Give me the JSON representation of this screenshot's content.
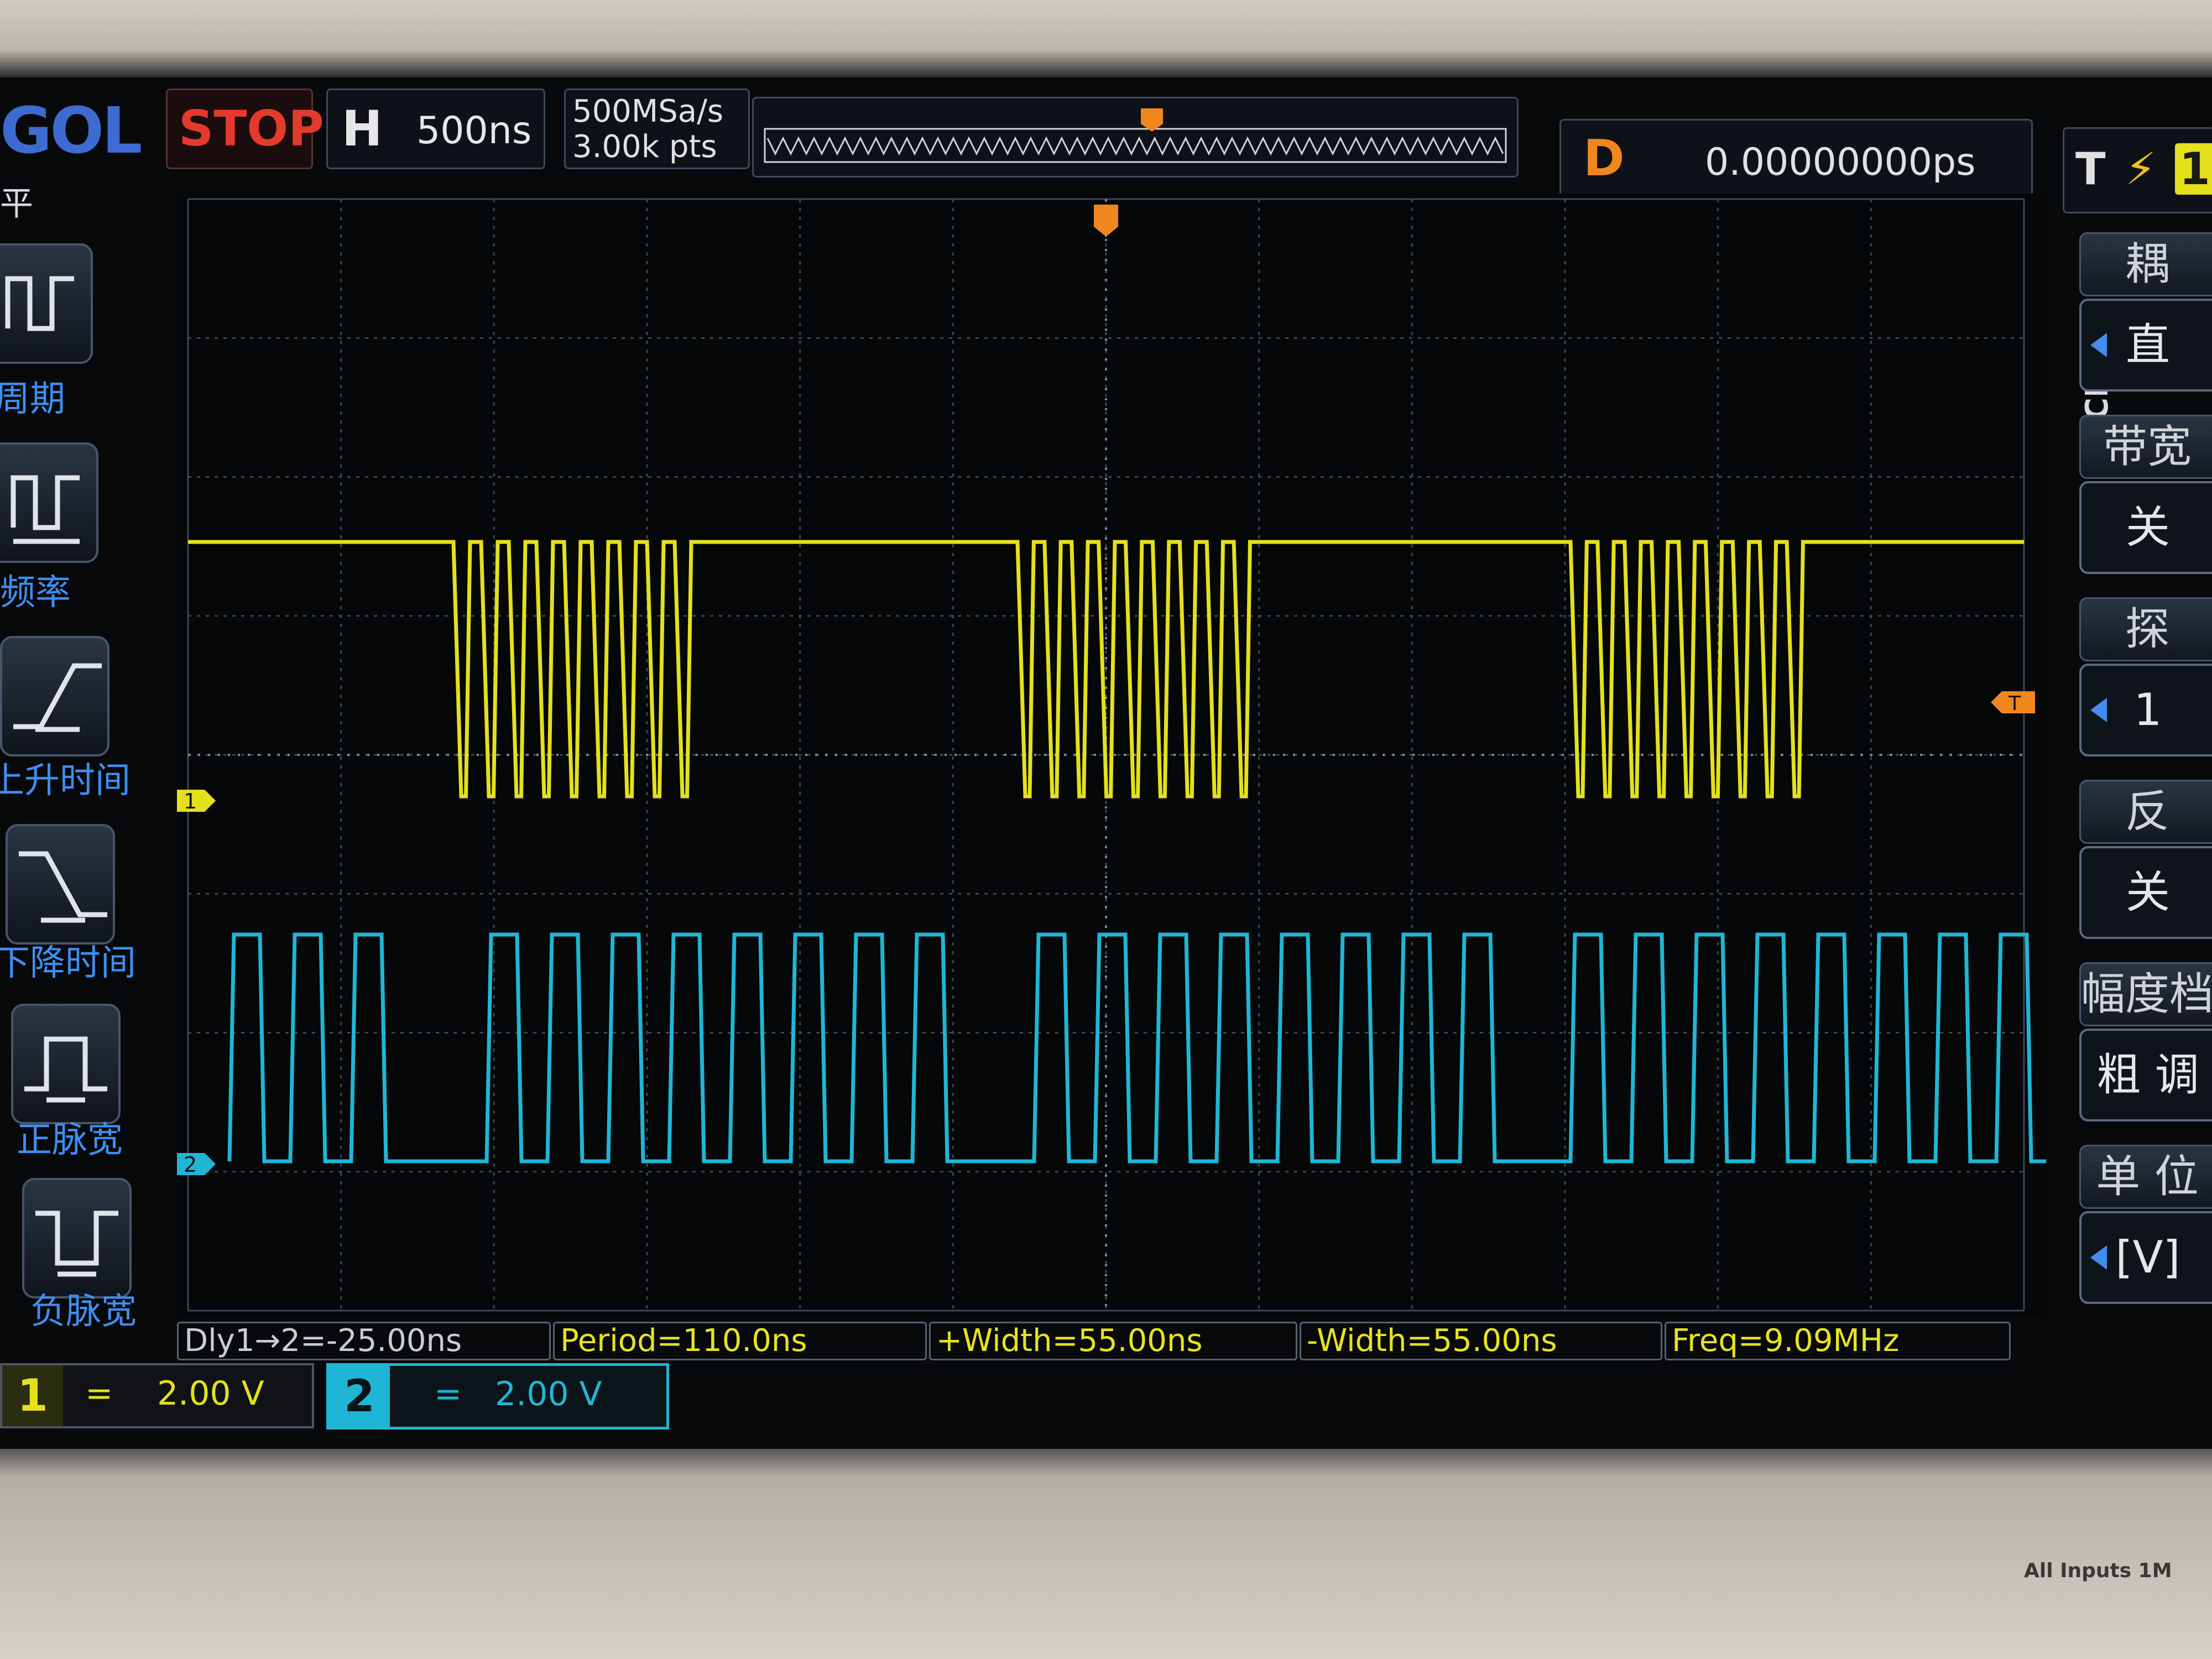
{
  "brand": "GOL",
  "header": {
    "run_state": "STOP",
    "timebase_label": "H",
    "timebase_value": "500ns",
    "sample_rate": "500MSa/s",
    "memory_depth": "3.00k pts",
    "delay_label": "D",
    "delay_value": "0.00000000ps",
    "trigger_label": "T",
    "trigger_source": "1"
  },
  "left_menu": {
    "header_partial": "平",
    "items": [
      {
        "label": "周期",
        "icon": "period-icon"
      },
      {
        "label": "频率",
        "icon": "frequency-icon"
      },
      {
        "label": "上升时间",
        "icon": "rise-time-icon"
      },
      {
        "label": "下降时间",
        "icon": "fall-time-icon"
      },
      {
        "label": "正脉宽",
        "icon": "positive-width-icon"
      },
      {
        "label": "负脉宽",
        "icon": "negative-width-icon"
      }
    ]
  },
  "right_menu": {
    "channel_tag": "CH2",
    "items": [
      {
        "label": "耦",
        "value": "直"
      },
      {
        "label": "带宽",
        "value": "关"
      },
      {
        "label": "探",
        "value": "1"
      },
      {
        "label": "反",
        "value": "关"
      },
      {
        "label": "幅度档",
        "value": "粗 调"
      },
      {
        "label": "单 位",
        "value": "[V]"
      }
    ]
  },
  "markers": {
    "ch1": "1",
    "ch2": "2",
    "trigger_level": "T"
  },
  "measurements": [
    {
      "text": "Dly1→2=-25.00ns",
      "color": "#c9ccd2"
    },
    {
      "text": "Period=110.0ns",
      "color": "#e7e31f"
    },
    {
      "text": "+Width=55.00ns",
      "color": "#e7e31f"
    },
    {
      "text": "-Width=55.00ns",
      "color": "#e7e31f"
    },
    {
      "text": "Freq=9.09MHz",
      "color": "#e7e31f"
    }
  ],
  "channels": [
    {
      "number": "1",
      "coupling": "=",
      "scale": "2.00 V",
      "color": "#e4e01c"
    },
    {
      "number": "2",
      "coupling": "=",
      "scale": "2.00 V",
      "color": "#1fb6d6"
    }
  ],
  "footer_text": "All Inputs 1M",
  "colors": {
    "ch1": "#e4e01c",
    "ch2": "#1fb6d6",
    "trigger": "#f0861e",
    "grid": "#3a4756",
    "stop": "#e43a2e"
  }
}
